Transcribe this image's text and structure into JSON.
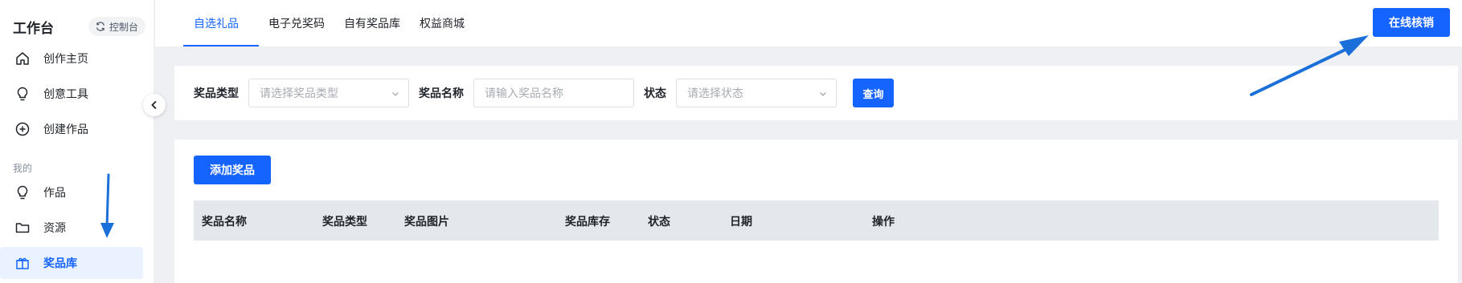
{
  "sidebar": {
    "title": "工作台",
    "console_label": "控制台",
    "section_label": "我的",
    "items": [
      {
        "label": "创作主页",
        "icon": "home-icon"
      },
      {
        "label": "创意工具",
        "icon": "lightbulb-icon"
      },
      {
        "label": "创建作品",
        "icon": "plus-circle-icon"
      },
      {
        "label": "作品",
        "icon": "lightbulb-icon"
      },
      {
        "label": "资源",
        "icon": "folder-icon"
      },
      {
        "label": "奖品库",
        "icon": "gift-icon",
        "active": true
      }
    ]
  },
  "tabs": [
    {
      "label": "自选礼品",
      "active": true
    },
    {
      "label": "电子兑奖码"
    },
    {
      "label": "自有奖品库"
    },
    {
      "label": "权益商城"
    }
  ],
  "header": {
    "verify_button": "在线核销"
  },
  "filters": {
    "prize_type_label": "奖品类型",
    "prize_type_placeholder": "请选择奖品类型",
    "prize_name_label": "奖品名称",
    "prize_name_placeholder": "请输入奖品名称",
    "status_label": "状态",
    "status_placeholder": "请选择状态",
    "query_button": "查询"
  },
  "table": {
    "add_button": "添加奖品",
    "columns": [
      "奖品名称",
      "奖品类型",
      "奖品图片",
      "奖品库存",
      "状态",
      "日期",
      "操作"
    ]
  },
  "colors": {
    "accent": "#1664ff",
    "annotation_arrow": "#1a6fd8"
  }
}
